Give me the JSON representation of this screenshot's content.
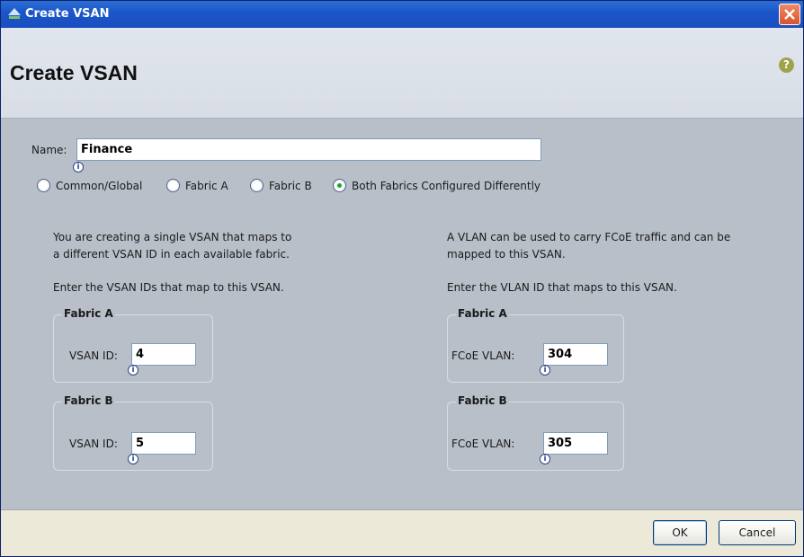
{
  "window": {
    "title": "Create VSAN",
    "close_symbol": "×"
  },
  "header": {
    "title": "Create VSAN",
    "help_symbol": "?"
  },
  "form": {
    "name_label": "Name:",
    "name_value": "Finance",
    "scope_options": [
      {
        "label": "Common/Global",
        "checked": false
      },
      {
        "label": "Fabric A",
        "checked": false
      },
      {
        "label": "Fabric B",
        "checked": false
      },
      {
        "label": "Both Fabrics Configured Differently",
        "checked": true
      }
    ],
    "vsan": {
      "description_line1": "You are creating a single VSAN that maps to",
      "description_line2": "a different VSAN ID in each available fabric.",
      "instruction": "Enter the VSAN IDs that map to this VSAN.",
      "fabric_a": {
        "legend": "Fabric A",
        "label": "VSAN ID:",
        "value": "4"
      },
      "fabric_b": {
        "legend": "Fabric B",
        "label": "VSAN ID:",
        "value": "5"
      }
    },
    "vlan": {
      "description_line1": "A VLAN can be used to carry FCoE traffic and can be",
      "description_line2": "mapped to this VSAN.",
      "instruction": "Enter the VLAN ID that maps to this VSAN.",
      "fabric_a": {
        "legend": "Fabric A",
        "label": "FCoE VLAN:",
        "value": "304"
      },
      "fabric_b": {
        "legend": "Fabric B",
        "label": "FCoE VLAN:",
        "value": "305"
      }
    },
    "info_marker_symbol": "i"
  },
  "footer": {
    "ok_label": "OK",
    "cancel_label": "Cancel"
  },
  "colors": {
    "titlebar": "#1b55c9",
    "radio_selected": "#23a12f",
    "close_button": "#d9532c"
  }
}
